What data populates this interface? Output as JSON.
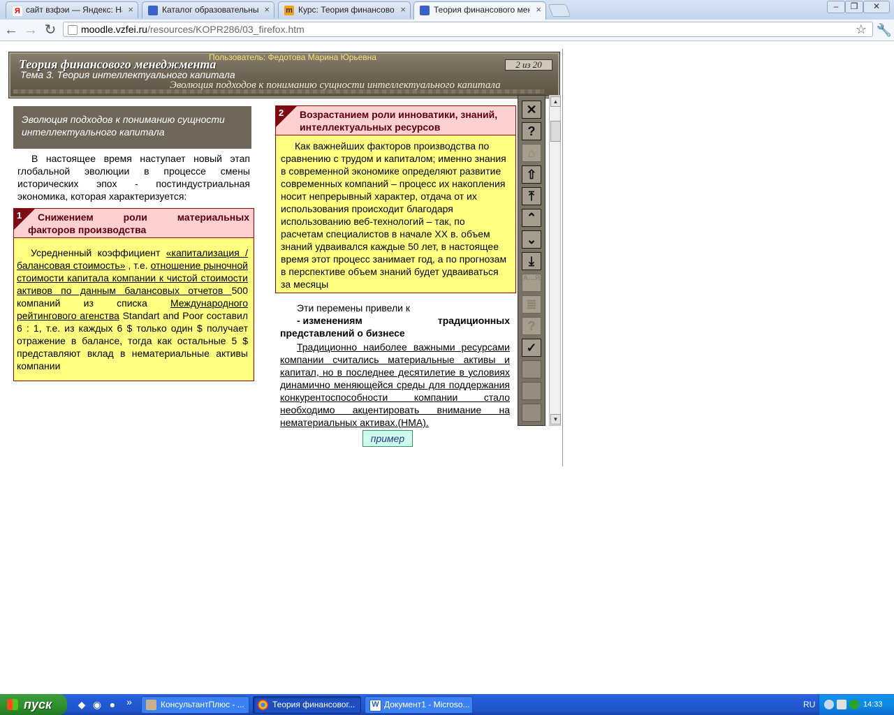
{
  "browser": {
    "tabs": [
      {
        "title": "сайт взфэи — Яндекс: Нашё",
        "favicon": "yandex-icon",
        "active": false
      },
      {
        "title": "Каталог образовательных р",
        "favicon": "page-icon",
        "active": false
      },
      {
        "title": "Курс: Теория финансового м",
        "favicon": "moodle-icon",
        "active": false
      },
      {
        "title": "Теория финансового менедж",
        "favicon": "page-icon",
        "active": true
      }
    ],
    "tab_close": "×",
    "url_host": "moodle.vzfei.ru",
    "url_path": "/resources/KOPR286/03_firefox.htm",
    "window_buttons": [
      "minimize",
      "maximize",
      "close"
    ]
  },
  "banner": {
    "course_title": "Теория финансового менеджмента",
    "user": "Пользователь: Федотова Марина Юрьевна",
    "topic": "Тема 3. Теория интеллектуального капитала",
    "subtitle": "Эволюция подходов к пониманию сущности интеллектуального капитала",
    "page": "2 из 20"
  },
  "left": {
    "heading": "Эволюция подходов к пониманию сущности интеллектуального капитала",
    "intro": "В настоящее время наступает новый этап глобальной эволюции в процессе смены исторических эпох  - постиндустриальная экономика, которая  характеризуется:",
    "box1": {
      "number": "1",
      "title_line1": [
        "Снижением",
        "роли",
        "материальных"
      ],
      "title_line2": "факторов производства",
      "body": {
        "p1": "Усредненный коэффициент ",
        "u1": "«капитализация / балансовая стоимость»",
        "p2": " , т.е. ",
        "u2": "отношение рыночной стоимости капитала компании к чистой стоимости активов по данным балансовых отчетов ",
        "p3": "  500 компаний из списка ",
        "u3": "Международного рейтингового агенства",
        "p4": " Standart and Poor  составил   6 : 1, т.е. из каждых  6 $ только один $ получает отражение в балансе, тогда как остальные  5 $  представляют вклад в нематериальные активы компании"
      }
    }
  },
  "right": {
    "box2": {
      "number": "2",
      "title": "Возрастанием роли инноватики, знаний, интеллектуальных ресурсов",
      "body": "Как важнейших факторов производства по сравнению с трудом и капиталом; именно знания в современной экономике определяют развитие современных компаний – процесс их накопления носит непрерывный характер, отдача от их использования происходит благодаря использованию веб-технологий – так, по расчетам специалистов в начале XX в. объем знаний удваивался каждые 50 лет, в настоящее время этот процесс занимает год, а по прогнозам в перспективе объем знаний будет удваиваться за месяцы"
    },
    "changes_intro": "Эти перемены  привели к",
    "changes_bullet_left": "- изменениям",
    "changes_bullet_right": "традиционных",
    "changes_bullet_cont": "представлений о бизнесе",
    "traditional": "Традиционно наиболее важными ресурсами компании считались материальные активы и капитал, но в последнее десятилетие в условиях динамично меняющейся  среды для поддержания конкурентоспособности компании стало необходимо акцентировать внимание на  нематериальных  активах.(НМА).",
    "example_button": "пример"
  },
  "nav_panel": {
    "buttons": [
      {
        "name": "close-nav-button",
        "glyph": "✕",
        "enabled": true
      },
      {
        "name": "help-nav-button",
        "glyph": "?",
        "enabled": true
      },
      {
        "name": "home-nav-button",
        "glyph": "⌂",
        "enabled": false
      },
      {
        "name": "up-nav-button",
        "glyph": "⇧",
        "enabled": true
      },
      {
        "name": "first-page-nav-button",
        "glyph": "⤒",
        "enabled": true
      },
      {
        "name": "prev-nav-button",
        "glyph": "⌃",
        "enabled": true
      },
      {
        "name": "next-nav-button",
        "glyph": "⌄",
        "enabled": true
      },
      {
        "name": "last-page-nav-button",
        "glyph": "⤓",
        "enabled": true
      },
      {
        "name": "glossary-nav-button",
        "glyph": "А…Я",
        "enabled": false
      },
      {
        "name": "notes-nav-button",
        "glyph": "≣",
        "enabled": false
      },
      {
        "name": "quiz-nav-button",
        "glyph": "?",
        "enabled": false
      },
      {
        "name": "check-nav-button",
        "glyph": "✓",
        "enabled": true
      },
      {
        "name": "blank-nav-button-1",
        "glyph": "",
        "enabled": false
      },
      {
        "name": "blank-nav-button-2",
        "glyph": "",
        "enabled": false
      },
      {
        "name": "blank-nav-button-3",
        "glyph": "",
        "enabled": false
      }
    ]
  },
  "taskbar": {
    "start_label": "пуск",
    "quick_launch_more": "»",
    "tasks": [
      {
        "title": "КонсультантПлюс - ...",
        "active": false
      },
      {
        "title": "Теория финансовог...",
        "active": true
      },
      {
        "title": "Документ1 - Microso...",
        "active": false
      }
    ],
    "language": "RU",
    "time": "14:33"
  }
}
